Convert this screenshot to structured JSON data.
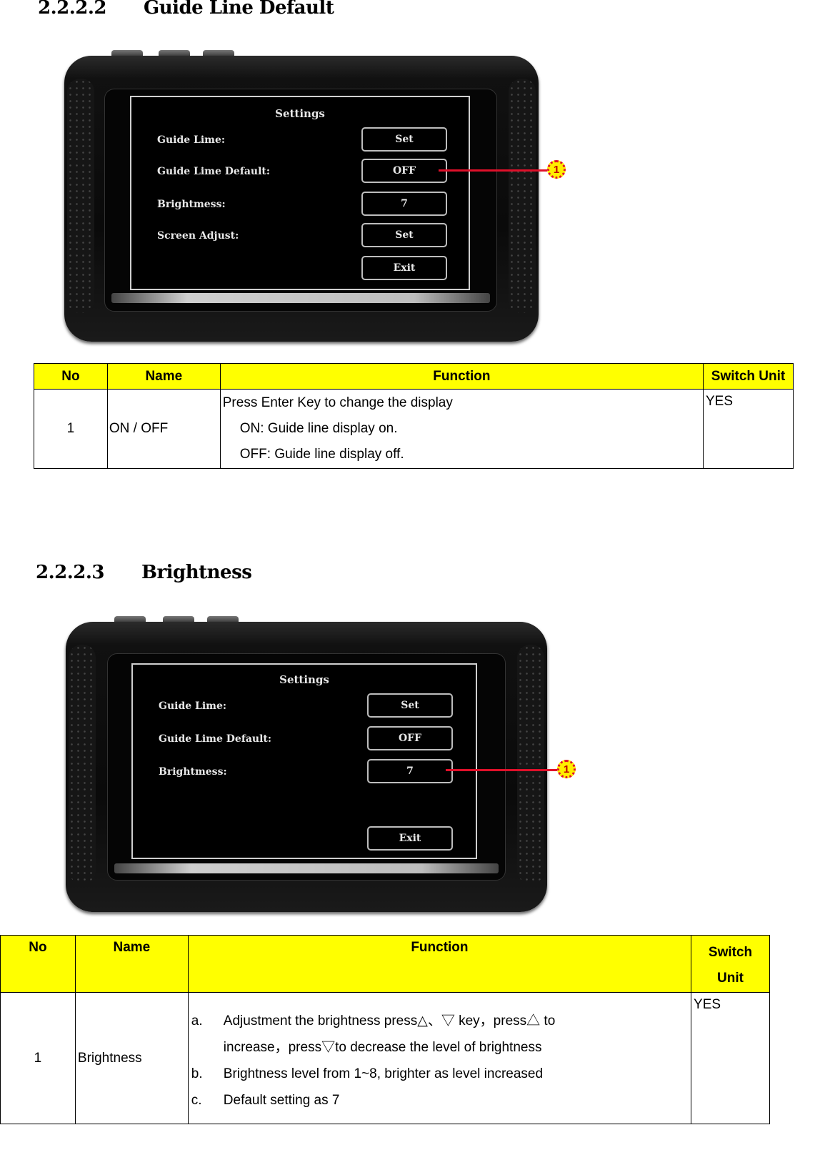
{
  "sections": [
    {
      "number": "2.2.2.2",
      "title": "Guide Line Default",
      "device_screen": {
        "title": "Settings",
        "rows": [
          {
            "label": "Guide Lime:",
            "button": "Set"
          },
          {
            "label": "Guide Lime Default:",
            "button": "OFF"
          },
          {
            "label": "Brightmess:",
            "button": "7"
          },
          {
            "label": "Screen Adjust:",
            "button": "Set"
          },
          {
            "label": "",
            "button": "Exit"
          }
        ],
        "callout": {
          "number": "1",
          "target_row": 1,
          "color": "#e0102a"
        }
      },
      "table": {
        "headers": [
          "No",
          "Name",
          "Function",
          "Switch Unit"
        ],
        "rows": [
          {
            "no": "1",
            "name": "ON / OFF",
            "function": [
              "Press Enter Key to change the display",
              "ON: Guide line display on.",
              "OFF: Guide line display off."
            ],
            "switch_unit": "YES"
          }
        ]
      }
    },
    {
      "number": "2.2.2.3",
      "title": "Brightness",
      "device_screen": {
        "title": "Settings",
        "rows": [
          {
            "label": "Guide Lime:",
            "button": "Set"
          },
          {
            "label": "Guide Lime Default:",
            "button": "OFF"
          },
          {
            "label": "Brightmess:",
            "button": "7"
          },
          {
            "label": "",
            "button": "Exit"
          }
        ],
        "callout": {
          "number": "1",
          "target_row": 2,
          "color": "#e0102a"
        }
      },
      "table": {
        "headers": [
          "No",
          "Name",
          "Function",
          "Switch",
          "Unit"
        ],
        "rows": [
          {
            "no": "1",
            "name": "Brightness",
            "function": [
              {
                "marker": "a.",
                "text": "Adjustment the brightness press△、▽  key，press△  to"
              },
              {
                "marker": "",
                "text": "increase，press▽to decrease the level of brightness"
              },
              {
                "marker": "b.",
                "text": "Brightness level from 1~8, brighter as level increased"
              },
              {
                "marker": "c.",
                "text": "Default setting as 7"
              }
            ],
            "switch_unit": "YES"
          }
        ]
      }
    }
  ],
  "colors": {
    "header_fill": "#ffff00",
    "callout_red": "#e0102a",
    "callout_badge": "#ffee00"
  }
}
